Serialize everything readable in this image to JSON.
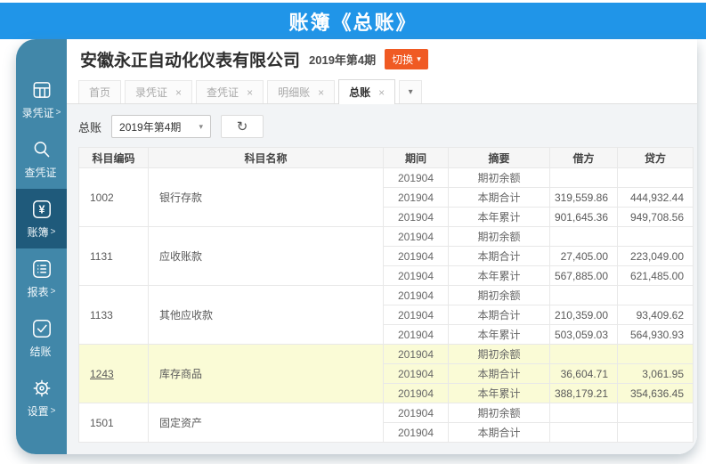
{
  "banner": {
    "title": "账簿《总账》"
  },
  "colors": {
    "banner_blue": "#2095e8",
    "sidebar_teal": "#4187a9",
    "sidebar_active": "#1f5a7b",
    "switch_orange": "#f05a23",
    "highlight_yellow": "#fafbd6"
  },
  "sidebar": {
    "items": [
      {
        "label": "录凭证",
        "arrow": ">",
        "icon": "voucher-form-icon",
        "active": false
      },
      {
        "label": "查凭证",
        "arrow": "",
        "icon": "search-icon",
        "active": false
      },
      {
        "label": "账簿",
        "arrow": ">",
        "icon": "yuan-ledger-icon",
        "active": true
      },
      {
        "label": "报表",
        "arrow": ">",
        "icon": "report-list-icon",
        "active": false
      },
      {
        "label": "结账",
        "arrow": "",
        "icon": "check-icon",
        "active": false
      },
      {
        "label": "设置",
        "arrow": ">",
        "icon": "gear-icon",
        "active": false
      }
    ]
  },
  "header": {
    "company_name": "安徽永正自动化仪表有限公司",
    "period": "2019年第4期",
    "switch_button": "切换",
    "switch_caret": "▾"
  },
  "tabs": {
    "close_glyph": "×",
    "overflow_caret": "▾",
    "items": [
      {
        "label": "首页",
        "closable": false,
        "active": false
      },
      {
        "label": "录凭证",
        "closable": true,
        "active": false
      },
      {
        "label": "查凭证",
        "closable": true,
        "active": false
      },
      {
        "label": "明细账",
        "closable": true,
        "active": false
      },
      {
        "label": "总账",
        "closable": true,
        "active": true
      }
    ]
  },
  "toolbar": {
    "label": "总账",
    "period_select_value": "2019年第4期",
    "select_caret": "▾",
    "refresh_icon": "↻"
  },
  "ledger_table": {
    "columns": [
      "科目编码",
      "科目名称",
      "期间",
      "摘要",
      "借方",
      "贷方"
    ],
    "groups": [
      {
        "code": "1002",
        "name": "银行存款",
        "highlight": false,
        "rows": [
          {
            "period": "201904",
            "summary": "期初余额",
            "debit": "",
            "credit": ""
          },
          {
            "period": "201904",
            "summary": "本期合计",
            "debit": "319,559.86",
            "credit": "444,932.44"
          },
          {
            "period": "201904",
            "summary": "本年累计",
            "debit": "901,645.36",
            "credit": "949,708.56"
          }
        ]
      },
      {
        "code": "1131",
        "name": "应收账款",
        "highlight": false,
        "rows": [
          {
            "period": "201904",
            "summary": "期初余额",
            "debit": "",
            "credit": ""
          },
          {
            "period": "201904",
            "summary": "本期合计",
            "debit": "27,405.00",
            "credit": "223,049.00"
          },
          {
            "period": "201904",
            "summary": "本年累计",
            "debit": "567,885.00",
            "credit": "621,485.00"
          }
        ]
      },
      {
        "code": "1133",
        "name": "其他应收款",
        "highlight": false,
        "rows": [
          {
            "period": "201904",
            "summary": "期初余额",
            "debit": "",
            "credit": ""
          },
          {
            "period": "201904",
            "summary": "本期合计",
            "debit": "210,359.00",
            "credit": "93,409.62"
          },
          {
            "period": "201904",
            "summary": "本年累计",
            "debit": "503,059.03",
            "credit": "564,930.93"
          }
        ]
      },
      {
        "code": "1243",
        "name": "库存商品",
        "highlight": true,
        "rows": [
          {
            "period": "201904",
            "summary": "期初余额",
            "debit": "",
            "credit": ""
          },
          {
            "period": "201904",
            "summary": "本期合计",
            "debit": "36,604.71",
            "credit": "3,061.95"
          },
          {
            "period": "201904",
            "summary": "本年累计",
            "debit": "388,179.21",
            "credit": "354,636.45"
          }
        ]
      },
      {
        "code": "1501",
        "name": "固定资产",
        "highlight": false,
        "rows": [
          {
            "period": "201904",
            "summary": "期初余额",
            "debit": "",
            "credit": ""
          },
          {
            "period": "201904",
            "summary": "本期合计",
            "debit": "",
            "credit": ""
          }
        ]
      }
    ]
  }
}
